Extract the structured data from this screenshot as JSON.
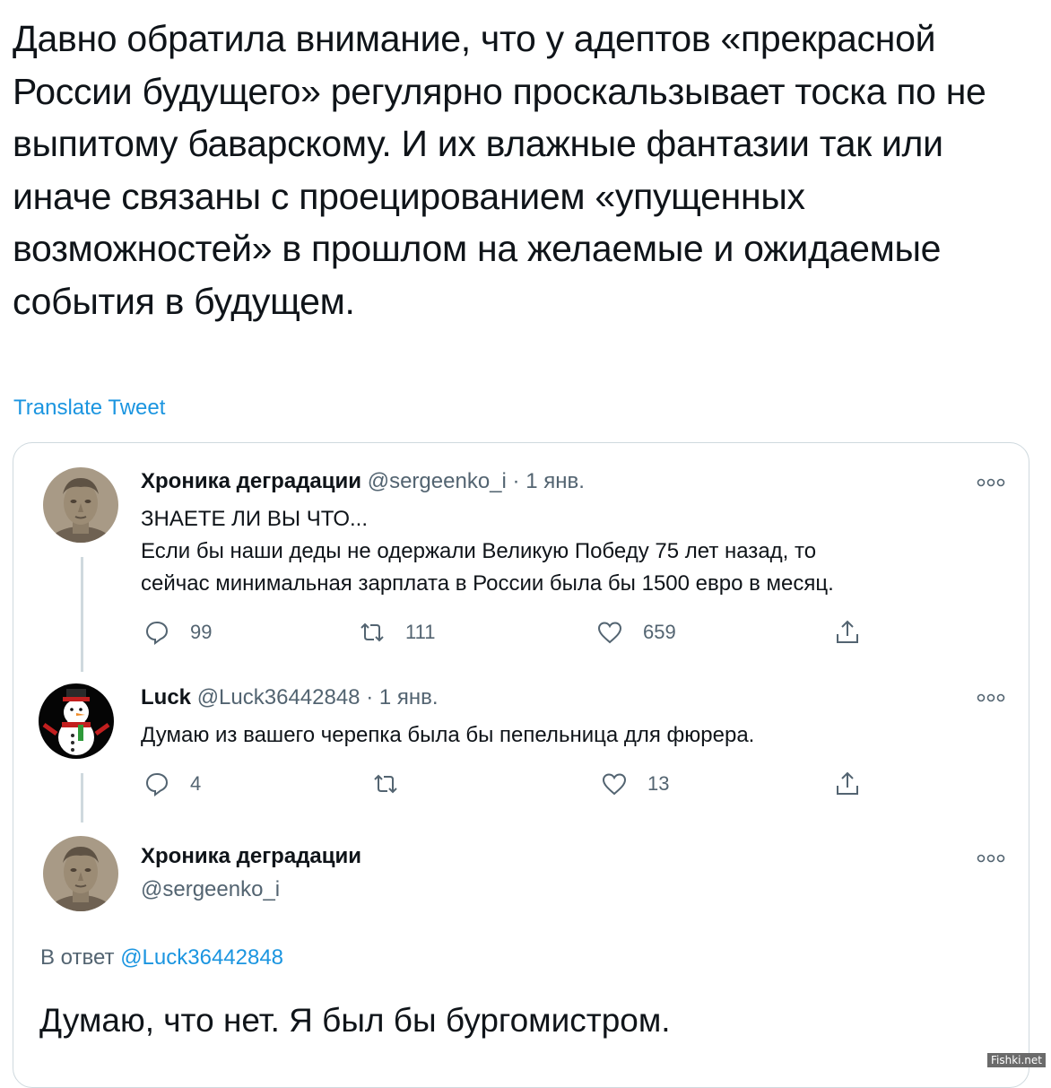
{
  "tweet": {
    "text": "Давно обратила внимание, что у адептов «прекрасной России будущего» регулярно проскальзывает тоска по не выпитому баварскому. И их влажные фантазии так или иначе связаны с проецированием «упущенных возможностей» в прошлом на желаемые и ожидаемые события в будущем.",
    "translate_label": "Translate Tweet"
  },
  "quoted": {
    "tweet1": {
      "name": "Хроника деградации",
      "handle": "@sergeenko_i",
      "dot": "·",
      "date": "1 янв.",
      "line1": "ЗНАЕТЕ ЛИ ВЫ ЧТО...",
      "line2": "Если бы наши деды не одержали Великую Победу 75 лет назад, то",
      "line3": "сейчас минимальная зарплата в России была бы 1500 евро в месяц.",
      "replies": "99",
      "retweets": "111",
      "likes": "659",
      "avatar_icon": "roman-bust-avatar"
    },
    "tweet2": {
      "name": "Luck",
      "handle": "@Luck36442848",
      "dot": "·",
      "date": "1 янв.",
      "text": "Думаю из вашего черепка была бы пепельница для фюрера.",
      "replies": "4",
      "retweets": "",
      "likes": "13",
      "avatar_icon": "snowman-avatar"
    },
    "tweet3": {
      "name": "Хроника деградации",
      "handle": "@sergeenko_i",
      "reply_prefix": "В ответ",
      "reply_to": "@Luck36442848",
      "text": "Думаю, что нет. Я был бы бургомистром.",
      "avatar_icon": "roman-bust-avatar"
    }
  },
  "watermark": "Fishki.net",
  "colors": {
    "link": "#1b95e0",
    "secondary_text": "#536471",
    "border": "#cfd9de",
    "primary_text": "#0f1419"
  }
}
